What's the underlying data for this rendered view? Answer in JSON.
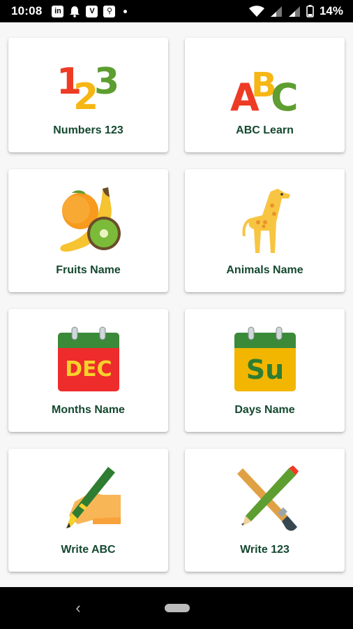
{
  "status_bar": {
    "time": "10:08",
    "battery": "14%",
    "icons": [
      "linkedin-icon",
      "notification-icon",
      "v-app-icon",
      "usb-icon",
      "wifi-icon",
      "signal-icon",
      "battery-icon"
    ]
  },
  "menu": {
    "items": [
      {
        "label": "Numbers 123",
        "icon": "numbers-123-icon"
      },
      {
        "label": "ABC Learn",
        "icon": "abc-letters-icon"
      },
      {
        "label": "Fruits Name",
        "icon": "fruits-icon"
      },
      {
        "label": "Animals Name",
        "icon": "giraffe-icon"
      },
      {
        "label": "Months Name",
        "icon": "calendar-dec-icon",
        "badge": "DEC"
      },
      {
        "label": "Days Name",
        "icon": "calendar-su-icon",
        "badge": "Su"
      },
      {
        "label": "Write ABC",
        "icon": "hand-pen-icon"
      },
      {
        "label": "Write 123",
        "icon": "pencil-brush-icon"
      }
    ]
  },
  "nav_bar": {
    "back_glyph": "‹"
  },
  "colors": {
    "label": "#14482f",
    "calendar_red": "#ee2c2c",
    "calendar_green": "#3a8a3a",
    "calendar_yellow": "#f2b600"
  }
}
